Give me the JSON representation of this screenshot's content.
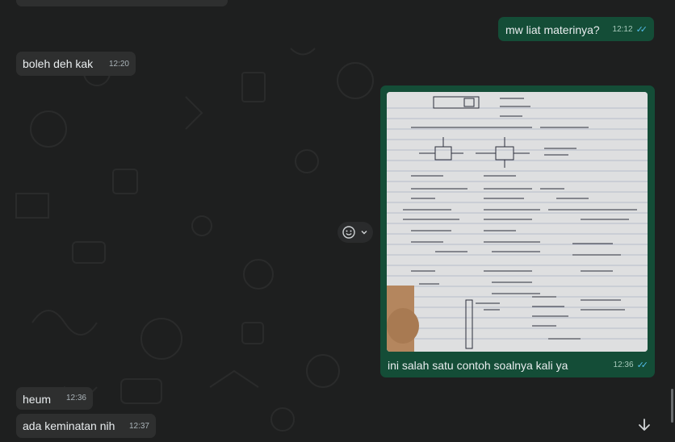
{
  "messages": [
    {
      "id": "m0",
      "direction": "incoming",
      "text": "",
      "time": ""
    },
    {
      "id": "m1",
      "direction": "outgoing",
      "text": "mw liat materinya?",
      "time": "12:12",
      "status": "read"
    },
    {
      "id": "m2",
      "direction": "incoming",
      "text": "boleh deh kak",
      "time": "12:20"
    },
    {
      "id": "m3",
      "direction": "outgoing",
      "type": "image",
      "caption": "ini salah satu contoh soalnya kali ya",
      "time": "12:36",
      "status": "read"
    },
    {
      "id": "m4",
      "direction": "incoming",
      "text": "heum",
      "time": "12:36"
    },
    {
      "id": "m5",
      "direction": "incoming",
      "text": "ada keminatan nih",
      "time": "12:37"
    }
  ],
  "icons": {
    "reaction": "smiley-icon",
    "reaction_menu": "chevron-down-icon",
    "scroll_down": "arrow-down-icon",
    "read_receipt": "double-check-icon"
  },
  "colors": {
    "background": "#1e1f1f",
    "incoming_bubble": "#2e2f2f",
    "outgoing_bubble": "#144d37",
    "read_tick": "#53bdeb"
  }
}
